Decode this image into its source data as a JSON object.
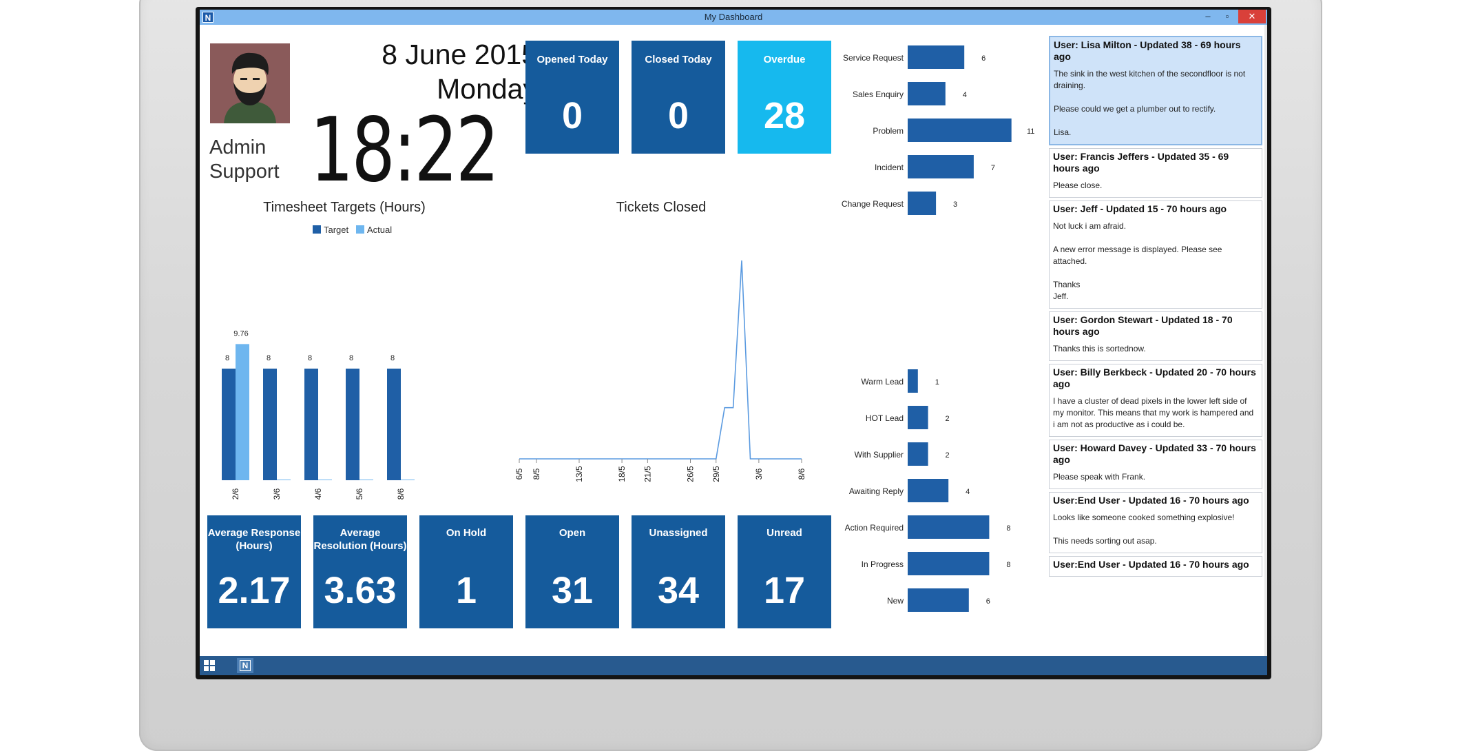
{
  "window": {
    "title": "My Dashboard",
    "app_letter": "N",
    "minimize": "–",
    "maximize": "▫",
    "close": "✕"
  },
  "profile": {
    "name_line1": "Admin",
    "name_line2": "Support"
  },
  "clock": {
    "date": "8 June 2015",
    "day": "Monday",
    "time": "18:22"
  },
  "top_tiles": [
    {
      "label": "Opened Today",
      "value": "0"
    },
    {
      "label": "Closed Today",
      "value": "0"
    },
    {
      "label": "Overdue",
      "value": "28"
    }
  ],
  "bottom_tiles": [
    {
      "label": "Average Response (Hours)",
      "value": "2.17"
    },
    {
      "label": "Average Resolution (Hours)",
      "value": "3.63"
    },
    {
      "label": "On Hold",
      "value": "1"
    },
    {
      "label": "Open",
      "value": "31"
    },
    {
      "label": "Unassigned",
      "value": "34"
    },
    {
      "label": "Unread",
      "value": "17"
    }
  ],
  "timesheet": {
    "title": "Timesheet Targets (Hours)",
    "legend_target": "Target",
    "legend_actual": "Actual"
  },
  "tickets_closed": {
    "title": "Tickets Closed"
  },
  "updates": [
    {
      "header": "User: Lisa Milton - Updated 38 - 69 hours ago",
      "body": "The sink in the west kitchen of the secondfloor is not draining.\n\nPlease could we get a plumber out to rectify.\n\nLisa.",
      "selected": true
    },
    {
      "header": "User: Francis Jeffers - Updated 35 - 69 hours ago",
      "body": "Please close."
    },
    {
      "header": "User: Jeff - Updated 15 - 70 hours ago",
      "body": "Not luck i am afraid.\n\nA new error message is displayed. Please see attached.\n\nThanks\nJeff."
    },
    {
      "header": "User: Gordon Stewart - Updated 18 - 70 hours ago",
      "body": "Thanks this is sortednow."
    },
    {
      "header": "User: Billy Berkbeck - Updated 20 - 70 hours ago",
      "body": "I have a cluster of dead pixels in the lower left side of my monitor. This means that my work is hampered and i am not as productive as i could be."
    },
    {
      "header": "User: Howard Davey - Updated 33 - 70 hours ago",
      "body": "Please speak with Frank."
    },
    {
      "header": "User:End User - Updated 16 - 70 hours ago",
      "body": "Looks like someone cooked something explosive!\n\nThis needs sorting out asap."
    },
    {
      "header": "User:End User - Updated 16 - 70 hours ago",
      "body": ""
    }
  ],
  "colors": {
    "tile": "#155b9c",
    "tile_highlight": "#16b9ee",
    "bar": "#1f5fa6",
    "actual": "#6eb6ef",
    "line": "#5a9ae0",
    "titlebar": "#7fb7ee",
    "taskbar": "#285a8f"
  },
  "chart_data": [
    {
      "type": "bar",
      "title": "Timesheet Targets (Hours)",
      "categories": [
        "2/6",
        "3/6",
        "4/6",
        "5/6",
        "8/6"
      ],
      "series": [
        {
          "name": "Target",
          "values": [
            8,
            8,
            8,
            8,
            8
          ]
        },
        {
          "name": "Actual",
          "values": [
            9.76,
            0,
            0,
            0,
            0
          ]
        }
      ],
      "data_labels": [
        "8",
        "9.76",
        "8",
        "8",
        "8",
        "8"
      ],
      "ylim": [
        0,
        12
      ],
      "legend": "top-center",
      "grid": false
    },
    {
      "type": "line",
      "title": "Tickets Closed",
      "x": [
        "6/5",
        "7/5",
        "8/5",
        "9/5",
        "10/5",
        "11/5",
        "12/5",
        "13/5",
        "14/5",
        "15/5",
        "16/5",
        "17/5",
        "18/5",
        "19/5",
        "20/5",
        "21/5",
        "22/5",
        "23/5",
        "24/5",
        "25/5",
        "26/5",
        "27/5",
        "28/5",
        "29/5",
        "30/5",
        "31/5",
        "1/6",
        "2/6",
        "3/6",
        "4/6",
        "5/6",
        "6/6",
        "7/6",
        "8/6"
      ],
      "tick_labels": [
        "6/5",
        "8/5",
        "13/5",
        "18/5",
        "21/5",
        "26/5",
        "29/5",
        "3/6",
        "8/6"
      ],
      "series": [
        {
          "values": [
            0,
            0,
            0,
            0,
            0,
            0,
            0,
            0,
            0,
            0,
            0,
            0,
            0,
            0,
            0,
            0,
            0,
            0,
            0,
            0,
            0,
            0,
            0,
            0,
            1.6,
            1.6,
            6.2,
            0,
            0,
            0,
            0,
            0,
            0,
            0
          ]
        }
      ],
      "ylim": [
        0,
        7
      ],
      "grid": false
    },
    {
      "type": "bar",
      "orientation": "horizontal",
      "categories": [
        "Service Request",
        "Sales Enquiry",
        "Problem",
        "Incident",
        "Change Request"
      ],
      "values": [
        6,
        4,
        11,
        7,
        3
      ],
      "xlim": [
        0,
        11
      ]
    },
    {
      "type": "bar",
      "orientation": "horizontal",
      "categories": [
        "Warm Lead",
        "HOT Lead",
        "With Supplier",
        "Awaiting Reply",
        "Action Required",
        "In Progress",
        "New"
      ],
      "values": [
        1,
        2,
        2,
        4,
        8,
        8,
        6
      ],
      "xlim": [
        0,
        8
      ]
    }
  ]
}
